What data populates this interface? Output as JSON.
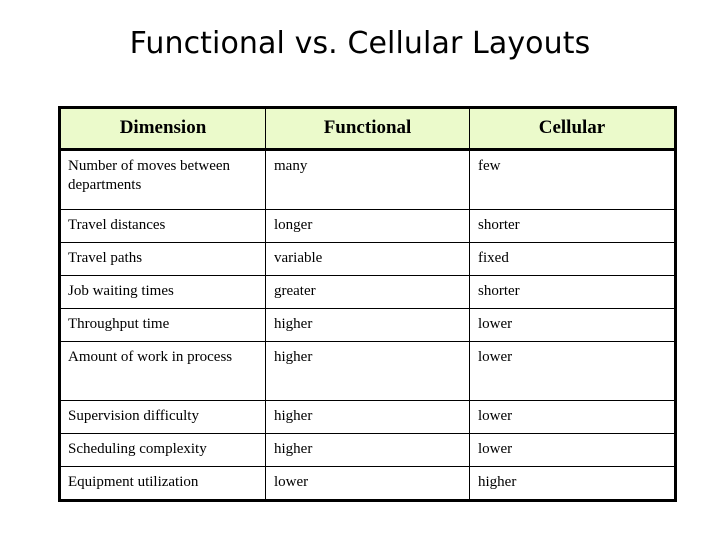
{
  "slide": {
    "title": "Functional vs. Cellular Layouts"
  },
  "colors": {
    "header_fill": "#EBFACB",
    "border": "#000000",
    "text": "#000000",
    "background": "#FFFFFF"
  },
  "table": {
    "columns": [
      "Dimension",
      "Functional",
      "Cellular"
    ],
    "rows": [
      {
        "dimension": "Number of moves between departments",
        "functional": "many",
        "cellular": "few",
        "size": "tall"
      },
      {
        "dimension": "Travel distances",
        "functional": "longer",
        "cellular": "shorter",
        "size": "short"
      },
      {
        "dimension": "Travel paths",
        "functional": "variable",
        "cellular": "fixed",
        "size": "short"
      },
      {
        "dimension": "Job waiting times",
        "functional": "greater",
        "cellular": "shorter",
        "size": "short"
      },
      {
        "dimension": "Throughput time",
        "functional": "higher",
        "cellular": "lower",
        "size": "short"
      },
      {
        "dimension": "Amount of work in process",
        "functional": "higher",
        "cellular": "lower",
        "size": "tall"
      },
      {
        "dimension": "Supervision difficulty",
        "functional": "higher",
        "cellular": "lower",
        "size": "short"
      },
      {
        "dimension": "Scheduling complexity",
        "functional": "higher",
        "cellular": "lower",
        "size": "short"
      },
      {
        "dimension": "Equipment utilization",
        "functional": "lower",
        "cellular": "higher",
        "size": "short"
      }
    ]
  }
}
